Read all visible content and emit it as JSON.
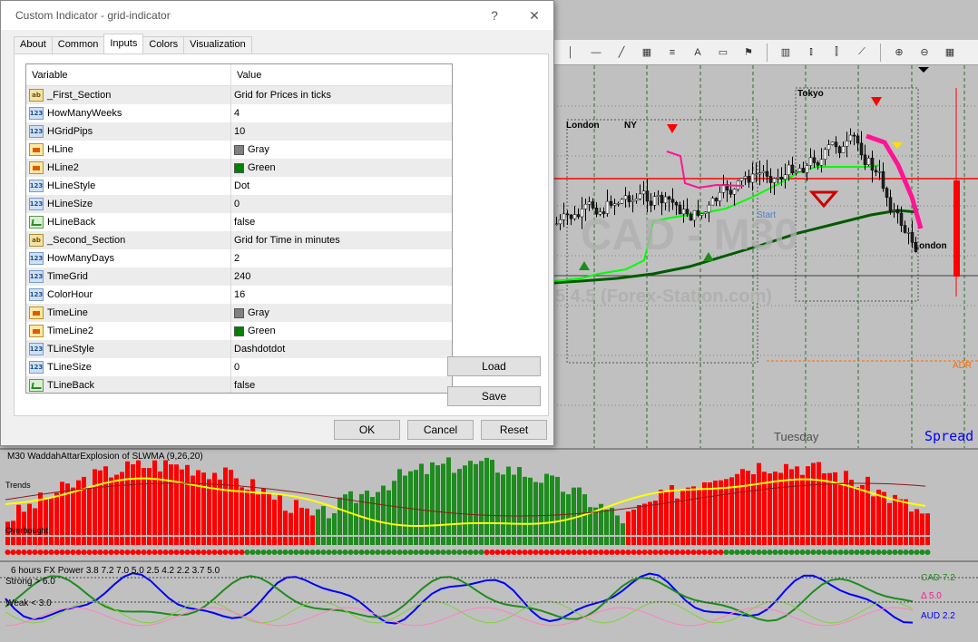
{
  "dialog": {
    "title": "Custom Indicator - grid-indicator",
    "help_label": "?",
    "close_label": "✕",
    "tabs": [
      {
        "label": "About"
      },
      {
        "label": "Common"
      },
      {
        "label": "Inputs"
      },
      {
        "label": "Colors"
      },
      {
        "label": "Visualization"
      }
    ],
    "active_tab": "Inputs",
    "grid": {
      "col_variable": "Variable",
      "col_value": "Value",
      "rows": [
        {
          "type": "ab",
          "variable": "_First_Section",
          "value": "Grid for Prices in ticks"
        },
        {
          "type": "num",
          "variable": "HowManyWeeks",
          "value": "4"
        },
        {
          "type": "num",
          "variable": "HGridPips",
          "value": "10"
        },
        {
          "type": "col",
          "variable": "HLine",
          "value": "Gray",
          "swatch": "#808080"
        },
        {
          "type": "col",
          "variable": "HLine2",
          "value": "Green",
          "swatch": "#008000"
        },
        {
          "type": "num",
          "variable": "HLineStyle",
          "value": "Dot"
        },
        {
          "type": "num",
          "variable": "HLineSize",
          "value": "0"
        },
        {
          "type": "bool",
          "variable": "HLineBack",
          "value": "false"
        },
        {
          "type": "ab",
          "variable": "_Second_Section",
          "value": "Grid for Time in minutes"
        },
        {
          "type": "num",
          "variable": "HowManyDays",
          "value": "2"
        },
        {
          "type": "num",
          "variable": "TimeGrid",
          "value": "240"
        },
        {
          "type": "num",
          "variable": "ColorHour",
          "value": "16"
        },
        {
          "type": "col",
          "variable": "TimeLine",
          "value": "Gray",
          "swatch": "#808080"
        },
        {
          "type": "col",
          "variable": "TimeLine2",
          "value": "Green",
          "swatch": "#008000"
        },
        {
          "type": "num",
          "variable": "TLineStyle",
          "value": "Dashdotdot"
        },
        {
          "type": "num",
          "variable": "TLineSize",
          "value": "0"
        },
        {
          "type": "bool",
          "variable": "TLineBack",
          "value": "false"
        }
      ]
    },
    "buttons": {
      "load": "Load",
      "save": "Save",
      "ok": "OK",
      "cancel": "Cancel",
      "reset": "Reset"
    }
  },
  "chart": {
    "sessions": {
      "london": "London",
      "ny": "NY",
      "tokyo": "Tokyo",
      "london2": "London"
    },
    "watermark": "CAD - M30",
    "watermark_sub": "5 4.5 (Forex-Station.com)",
    "weekday": "Tuesday",
    "spread_label": "Spread",
    "adr_label": "ADR",
    "start_label": "Start",
    "indicator1_title": "M30 WaddahAttarExplosion of SLWMA (9,26,20)",
    "indicator1_label_a": "Trends",
    "indicator1_label_b": "Overbought",
    "indicator2_title": "6 hours FX Power 3.8 7.2 7.0 5.0 2.5 4.2 2.2 3.7 5.0",
    "indicator2_strong": "Strong > 6.0",
    "indicator2_weak": "Weak < 3.0",
    "legend_cad": "CAD 7.2",
    "legend_delta": "Δ 5.0",
    "legend_aud": "AUD 2.2"
  },
  "colors": {
    "bull": "#1e8c1e",
    "bear": "#ff0000",
    "ma_dark": "#005a00",
    "accent_blue": "#0000ff",
    "pink": "#ff1493"
  }
}
